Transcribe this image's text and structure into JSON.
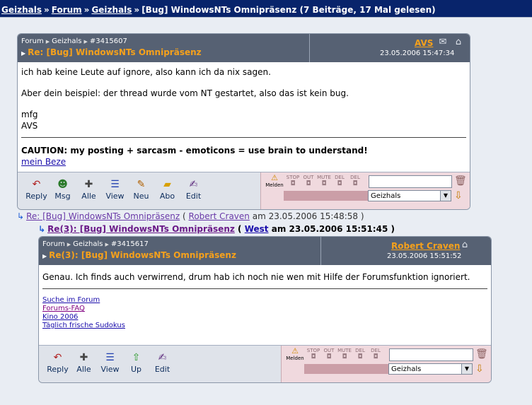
{
  "breadcrumb": {
    "items": [
      "Geizhals",
      "Forum",
      "Geizhals"
    ],
    "separator": "»",
    "current": "[Bug] WindowsNTs Omnipräsenz (7 Beiträge, 17 Mal gelesen)"
  },
  "posts": [
    {
      "crumb": {
        "a": "Forum",
        "b": "Geizhals",
        "id": "#3415607"
      },
      "subject": "Re: [Bug] WindowsNTs Omnipräsenz",
      "author": "AVS",
      "date": "23.05.2006 15:47:34",
      "body": [
        "ich hab keine Leute auf ignore, also kann ich da nix sagen.",
        "Aber dein beispiel: der thread wurde vom NT gestartet, also das ist kein bug.",
        "mfg",
        "AVS"
      ],
      "signature": "CAUTION: my posting + sarcasm - emoticons =  use brain to understand!",
      "link": "mein Beze",
      "tools": [
        "Reply",
        "Msg",
        "Alle",
        "View",
        "Neu",
        "Abo",
        "Edit"
      ],
      "mod": [
        "Melden",
        "STOP",
        "OUT",
        "MUTE",
        "DEL",
        "DEL"
      ],
      "forum_select": "Geizhals"
    },
    {
      "crumb": {
        "a": "Forum",
        "b": "Geizhals",
        "id": "#3415617"
      },
      "subject": "Re(3): [Bug] WindowsNTs Omnipräsenz",
      "author": "Robert Craven",
      "date": "23.05.2006 15:51:52",
      "body": [
        "Genau. Ich finds auch verwirrend, drum hab ich noch nie wen mit Hilfe der Forumsfunktion ignoriert."
      ],
      "sig_links": [
        "Suche im Forum",
        "Forums-FAQ",
        "Kino 2006",
        "Täglich frische Sudokus"
      ],
      "tools": [
        "Reply",
        "Alle",
        "View",
        "Up",
        "Edit"
      ],
      "mod": [
        "Melden",
        "STOP",
        "OUT",
        "MUTE",
        "DEL",
        "DEL"
      ],
      "forum_select": "Geizhals"
    }
  ],
  "thread_items": [
    {
      "subject": "Re: [Bug] WindowsNTs Omnipräsenz",
      "author": "Robert Craven",
      "on": "am",
      "date": "23.05.2006 15:48:58"
    },
    {
      "subject": "Re(3): [Bug] WindowsNTs Omnipräsenz",
      "author": "West",
      "on": "am",
      "date": "23.05.2006 15:51:45"
    }
  ],
  "icons": {
    "mail": "envelope-icon",
    "home": "home-icon",
    "reply": "reply-arrow-icon",
    "msg": "people-icon",
    "alle": "plus-icon",
    "view": "list-icon",
    "neu": "pencil-icon",
    "abo": "folder-icon",
    "edit": "edit-icon",
    "up": "up-arrow-icon"
  }
}
